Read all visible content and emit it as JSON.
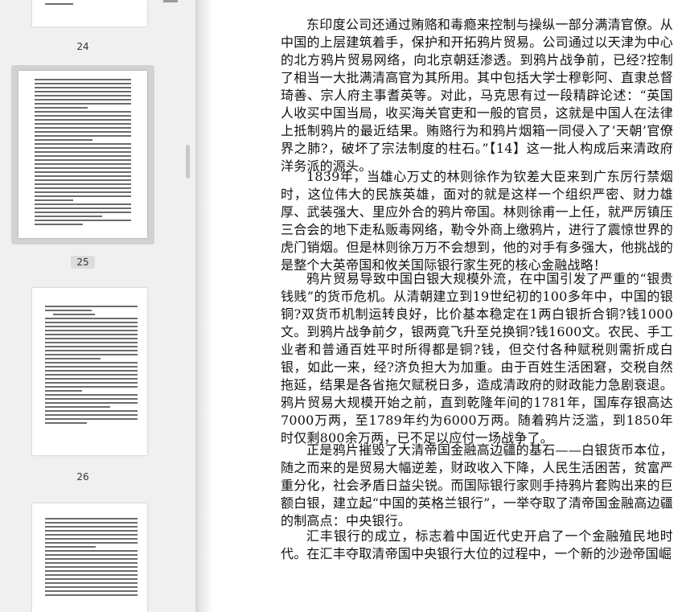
{
  "sidebar": {
    "pages": [
      {
        "label": "24",
        "selected": false
      },
      {
        "label": "25",
        "selected": true
      },
      {
        "label": "26",
        "selected": false
      }
    ]
  },
  "document": {
    "paragraphs": [
      "东印度公司还通过贿赂和毒瘾来控制与操纵一部分满清官僚。从中国的上层建筑着手，保护和开拓鸦片贸易。公司通过以天津为中心的北方鸦片贸易网络，向北京朝廷渗透。到鸦片战争前，已经?控制了相当一大批满清高官为其所用。其中包括大学士穆彰阿、直隶总督琦善、宗人府主事耆英等。对此，马克思有过一段精辟论述：“英国人收买中国当局，收买海关官吏和一般的官员，这就是中国人在法律上抵制鸦片的最近结果。贿赂行为和鸦片烟箱一同侵入了‘天朝’官僚界之肺?，破坏了宗法制度的柱石。”【14】这一批人构成后来清政府洋务派的源头。",
      "1839年，当雄心万丈的林则徐作为钦差大臣来到广东厉行禁烟时，这位伟大的民族英雄，面对的就是这样一个组织严密、财力雄厚、武装强大、里应外合的鸦片帝国。林则徐甫一上任，就严厉镇压三合会的地下走私贩毒网络，勒令外商上缴鸦片，进行了震惊世界的虎门销烟。但是林则徐万万不会想到，他的对手有多强大，他挑战的是整个大英帝国和攸关国际银行家生死的核心金融战略！",
      "鸦片贸易导致中国白银大规模外流，在中国引发了严重的“银贵钱贱”的货币危机。从清朝建立到19世纪初的100多年中，中国的银铜?双货币机制运转良好，比价基本稳定在1两白银折合铜?钱1000文。到鸦片战争前夕，银两竟飞升至兑换铜?钱1600文。农民、手工业者和普通百姓平时所得都是铜?钱，但交付各种赋税则需折成白银，如此一来，经?济负担大为加重。由于百姓生活困窘，交税自然拖延，结果是各省拖欠赋税日多，造成清政府的财政能力急剧衰退。鸦片贸易大规模开始之前，直到乾隆年间的1781年，国库存银高达7000万两，至1789年约为6000万两。随着鸦片泛滥，到1850年时仅剩800余万两，已不足以应付一场战争了。",
      "正是鸦片摧毁了大清帝国金融高边疆的基石——白银货币本位，随之而来的是贸易大幅逆差，财政收入下降，人民生活困苦，贫富严重分化，社会矛盾日益尖锐。而国际银行家则手持鸦片套购出来的巨额白银，建立起“中国的英格兰银行”，一举夺取了清帝国金融高边疆的制高点：中央银行。",
      "汇丰银行的成立，标志着中国近代史开启了一个金融殖民地时代。在汇丰夺取清帝国中央银行大位的过程中，一个新的沙逊帝国崛"
    ]
  }
}
